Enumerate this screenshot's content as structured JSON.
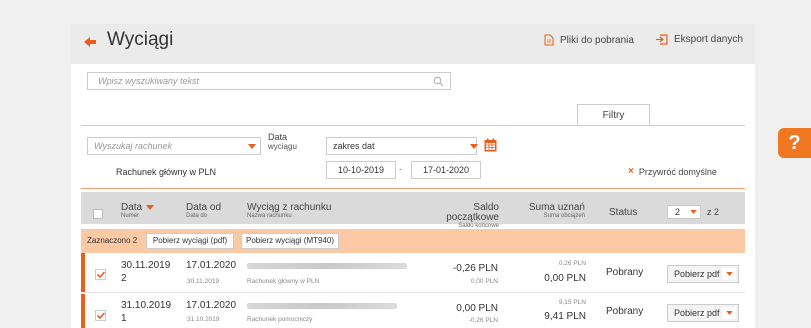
{
  "header": {
    "title": "Wyciągi",
    "downloads_label": "Pliki do pobrania",
    "export_label": "Eksport danych"
  },
  "search": {
    "placeholder": "Wpisz wyszukiwany tekst"
  },
  "filters": {
    "tab_label": "Filtry",
    "account_placeholder": "Wyszukaj rachunek",
    "account_name": "Rachunek główny w PLN",
    "date_label": "Data",
    "date_sublabel": "wyciągu",
    "range_value": "zakres dat",
    "date_from": "10-10-2019",
    "date_sep": "-",
    "date_to": "17-01-2020",
    "reset_label": "Przywróć domyślne"
  },
  "table": {
    "columns": {
      "date": "Data",
      "date_sub": "Numer",
      "date_from": "Data od",
      "date_from_sub": "Data do",
      "statement": "Wyciąg z rachunku",
      "statement_sub": "Nazwa rachunku",
      "balance": "Saldo początkowe",
      "balance_sub": "Saldo końcowe",
      "credits": "Suma uznań",
      "credits_sub": "Suma obciążeń",
      "status": "Status"
    },
    "pager": {
      "page": "2",
      "of": "z 2"
    },
    "selection": {
      "label": "Zaznaczono 2",
      "btn_pdf": "Pobierz wyciągi (pdf)",
      "btn_mt940": "Pobierz wyciągi (MT940)"
    },
    "rows": [
      {
        "date": "30.11.2019",
        "number": "2",
        "date_from": "17.01.2020",
        "date_to": "30.11.2019",
        "account": "Rachunek główny w PLN",
        "balance_start": "-0,26 PLN",
        "balance_end": "0,00 PLN",
        "credits": "0,26 PLN",
        "debits": "0,00 PLN",
        "status": "Pobrany",
        "action": "Pobierz pdf"
      },
      {
        "date": "31.10.2019",
        "number": "1",
        "date_from": "17.01.2020",
        "date_to": "31.10.2019",
        "account": "Rachunek pomocniczy",
        "balance_start": "0,00 PLN",
        "balance_end": "-0,26 PLN",
        "credits": "9,15 PLN",
        "debits": "9,41 PLN",
        "status": "Pobrany",
        "action": "Pobierz pdf"
      }
    ]
  },
  "help": {
    "label": "?"
  },
  "colors": {
    "accent": "#e8601c",
    "selection": "#fbc9a3",
    "header_bg": "#dadada"
  }
}
